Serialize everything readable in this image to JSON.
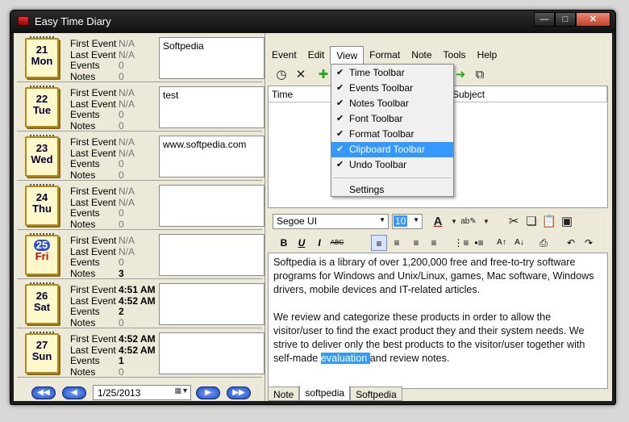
{
  "window": {
    "title": "Easy Time Diary"
  },
  "days": [
    {
      "num": "21",
      "dow": "Mon",
      "first_label": "First Event",
      "first": "N/A",
      "last_label": "Last Event",
      "last": "N/A",
      "events_label": "Events",
      "events": "0",
      "notes_label": "Notes",
      "notes": "0",
      "note": "Softpedia"
    },
    {
      "num": "22",
      "dow": "Tue",
      "first_label": "First Event",
      "first": "N/A",
      "last_label": "Last Event",
      "last": "N/A",
      "events_label": "Events",
      "events": "0",
      "notes_label": "Notes",
      "notes": "0",
      "note": "test"
    },
    {
      "num": "23",
      "dow": "Wed",
      "first_label": "First Event",
      "first": "N/A",
      "last_label": "Last Event",
      "last": "N/A",
      "events_label": "Events",
      "events": "0",
      "notes_label": "Notes",
      "notes": "0",
      "note": "www.softpedia.com"
    },
    {
      "num": "24",
      "dow": "Thu",
      "first_label": "First Event",
      "first": "N/A",
      "last_label": "Last Event",
      "last": "N/A",
      "events_label": "Events",
      "events": "0",
      "notes_label": "Notes",
      "notes": "0",
      "note": ""
    },
    {
      "num": "25",
      "dow": "Fri",
      "first_label": "First Event",
      "first": "N/A",
      "last_label": "Last Event",
      "last": "N/A",
      "events_label": "Events",
      "events": "0",
      "notes_label": "Notes",
      "notes": "3",
      "note": ""
    },
    {
      "num": "26",
      "dow": "Sat",
      "first_label": "First Event",
      "first": "4:51 AM",
      "last_label": "Last Event",
      "last": "4:52 AM",
      "events_label": "Events",
      "events": "2",
      "notes_label": "Notes",
      "notes": "0",
      "note": ""
    },
    {
      "num": "27",
      "dow": "Sun",
      "first_label": "First Event",
      "first": "4:52 AM",
      "last_label": "Last Event",
      "last": "4:52 AM",
      "events_label": "Events",
      "events": "1",
      "notes_label": "Notes",
      "notes": "0",
      "note": ""
    }
  ],
  "nav": {
    "date": "1/25/2013",
    "first_icon": "rewind-icon",
    "prev_icon": "back-icon",
    "next_icon": "forward-icon",
    "last_icon": "fast-forward-icon"
  },
  "menubar": [
    "Event",
    "Edit",
    "View",
    "Format",
    "Note",
    "Tools",
    "Help"
  ],
  "view_menu": {
    "items": [
      {
        "label": "Time Toolbar",
        "checked": true
      },
      {
        "label": "Events Toolbar",
        "checked": true
      },
      {
        "label": "Notes Toolbar",
        "checked": true
      },
      {
        "label": "Font Toolbar",
        "checked": true
      },
      {
        "label": "Format Toolbar",
        "checked": true
      },
      {
        "label": "Clipboard Toolbar",
        "checked": true
      },
      {
        "label": "Undo Toolbar",
        "checked": true
      }
    ],
    "settings": "Settings",
    "check_glyph": "✔"
  },
  "event_columns": {
    "time": "Time",
    "subject": "Subject"
  },
  "format": {
    "font": "Segoe UI",
    "size": "10"
  },
  "editor": {
    "p1": "Softpedia is a library of over 1,200,000 free and free-to-try software programs for Windows and Unix/Linux, games, Mac software, Windows drivers, mobile devices and IT-related articles.",
    "p2_before": "We review and categorize these products in order to allow the visitor/user to find the exact product they and their system needs. We strive to deliver only the best products to the visitor/user together with self-made ",
    "p2_selected": "evaluation ",
    "p2_after": "and review notes."
  },
  "tabs": [
    "Note",
    "softpedia",
    "Softpedia"
  ],
  "active_tab": 1,
  "colors": {
    "accent": "#3399ff",
    "calendar_border": "#b38a1a",
    "today_circle": "#2b4fd0"
  }
}
